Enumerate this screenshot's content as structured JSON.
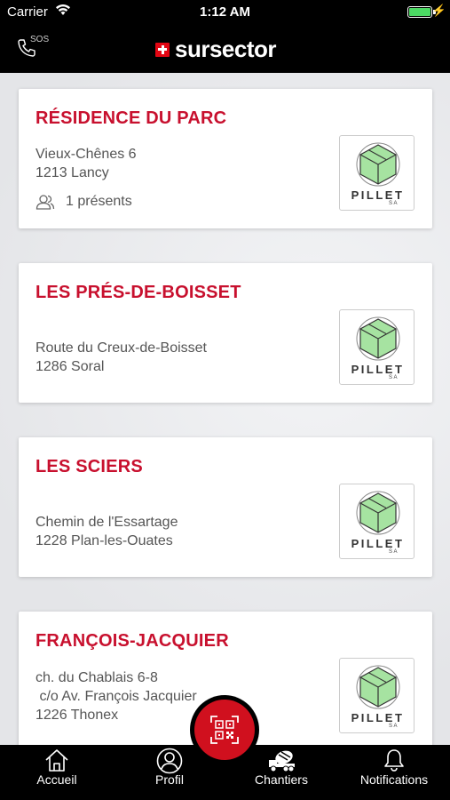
{
  "status_bar": {
    "carrier": "Carrier",
    "time": "1:12 AM",
    "battery_level": 1.0
  },
  "header": {
    "sos_label": "SOS",
    "brand_name": "sursector"
  },
  "sites": [
    {
      "title": "RÉSIDENCE DU PARC",
      "address": "Vieux-Chênes 6\n1213 Lancy",
      "presence": "1 présents",
      "logo_text": "PILLET",
      "logo_sub": "SA"
    },
    {
      "title": "LES PRÉS-DE-BOISSET",
      "address": "Route du Creux-de-Boisset\n1286 Soral",
      "presence": "",
      "logo_text": "PILLET",
      "logo_sub": "SA"
    },
    {
      "title": "LES SCIERS",
      "address": "Chemin de l'Essartage\n1228 Plan-les-Ouates",
      "presence": "",
      "logo_text": "PILLET",
      "logo_sub": "SA"
    },
    {
      "title": "FRANÇOIS-JACQUIER",
      "address": "ch. du Chablais 6-8\n c/o Av. François Jacquier\n1226 Thonex",
      "presence": "",
      "logo_text": "PILLET",
      "logo_sub": "SA"
    }
  ],
  "tabs": [
    {
      "label": "Accueil",
      "icon": "home-icon"
    },
    {
      "label": "Profil",
      "icon": "profile-icon"
    },
    {
      "label": "Chantiers",
      "icon": "concrete-mixer-icon"
    },
    {
      "label": "Notifications",
      "icon": "bell-icon"
    }
  ],
  "colors": {
    "accent": "#c8102e",
    "bar": "#000000",
    "scan_button": "#d0101e"
  }
}
